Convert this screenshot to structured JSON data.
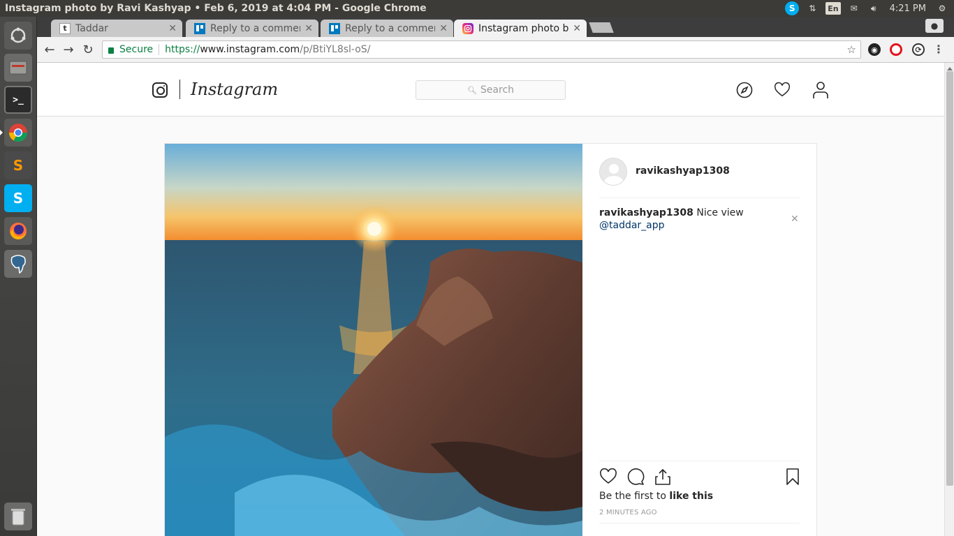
{
  "system": {
    "window_title": "Instagram photo by Ravi Kashyap • Feb 6, 2019 at 4:04 PM - Google Chrome",
    "keyboard_layout": "En",
    "time": "4:21 PM"
  },
  "launcher": [
    "dash",
    "files",
    "terminal",
    "chrome",
    "sublime-text",
    "skype",
    "firefox",
    "pgadmin",
    "trash"
  ],
  "tabs": [
    {
      "favicon": "t",
      "label": "Taddar",
      "active": false
    },
    {
      "favicon": "trello-icon",
      "label": "Reply to a comment",
      "active": false
    },
    {
      "favicon": "trello-icon",
      "label": "Reply to a comment",
      "active": false
    },
    {
      "favicon": "instagram-icon",
      "label": "Instagram photo by",
      "active": true
    }
  ],
  "omnibox": {
    "secure_label": "Secure",
    "protocol": "https://",
    "host": "www.instagram.com",
    "path": "/p/BtiYL8sl-oS/"
  },
  "ig": {
    "wordmark": "Instagram",
    "search_placeholder": "Search",
    "post": {
      "username": "ravikashyap1308",
      "caption_user": "ravikashyap1308",
      "caption_text": " Nice view",
      "mention": "@taddar_app",
      "likes_prefix": "Be the first to ",
      "likes_cta": "like this",
      "time_ago": "2 MINUTES AGO"
    }
  },
  "colors": {
    "ubuntu_panel": "#3c3b37",
    "chrome_secure": "#0b8043",
    "ig_text": "#262626",
    "ig_link": "#003569",
    "ig_border": "#dbdbdb"
  }
}
